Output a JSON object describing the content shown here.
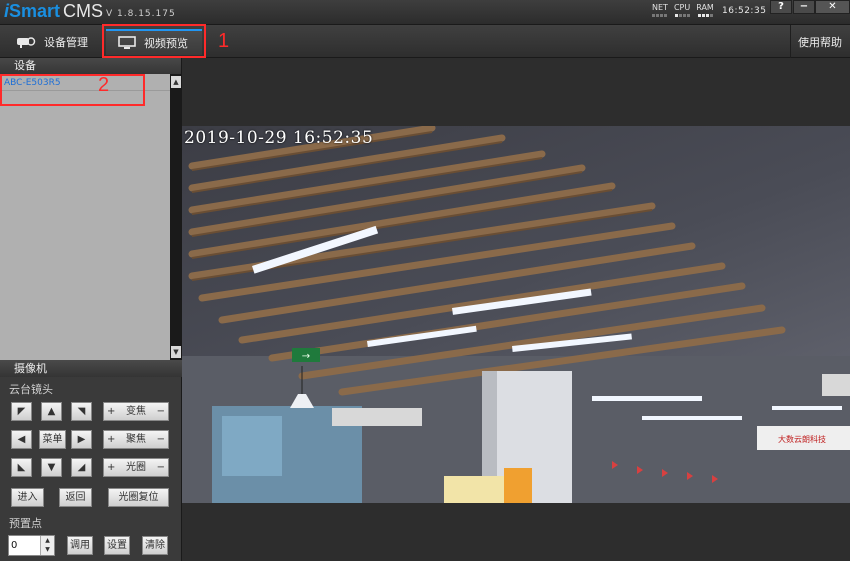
{
  "app": {
    "logo_i": "i",
    "logo_smart": "Smart",
    "logo_cms": "CMS",
    "version": "V 1.8.15.175"
  },
  "status": {
    "meters": [
      {
        "label": "NET",
        "dots_on": 0
      },
      {
        "label": "CPU",
        "dots_on": 1
      },
      {
        "label": "RAM",
        "dots_on": 3
      }
    ],
    "clock": "16:52:35"
  },
  "window_controls": {
    "help": "?",
    "minimize": "−",
    "close": "✕"
  },
  "toolbar": {
    "device_mgmt": "设备管理",
    "video_preview": "视频预览",
    "help": "使用帮助"
  },
  "annotations": {
    "one": "1",
    "two": "2"
  },
  "device_panel": {
    "title": "设备",
    "items": [
      {
        "label": "ABC-E503R5"
      }
    ]
  },
  "camera_panel": {
    "title": "摄像机",
    "ptz_label": "云台镜头",
    "arrows": {
      "up_left": "◤",
      "up": "▲",
      "up_right": "◥",
      "left": "◀",
      "menu": "菜单",
      "right": "▶",
      "down_left": "◣",
      "down": "▼",
      "down_right": "◢"
    },
    "zoom": {
      "plus": "+",
      "label": "变焦",
      "minus": "−"
    },
    "focus": {
      "plus": "+",
      "label": "聚焦",
      "minus": "−"
    },
    "iris": {
      "plus": "+",
      "label": "光圈",
      "minus": "−"
    },
    "enter": "进入",
    "back": "返回",
    "iris_reset": "光圈复位",
    "preset_label": "预置点",
    "preset_value": "0",
    "call": "调用",
    "set": "设置",
    "clear": "清除"
  },
  "video": {
    "osd_timestamp": "2019-10-29 16:52:35",
    "exit_sign": "→",
    "wall_sign": "大数云朗科技"
  },
  "colors": {
    "accent": "#2196f3",
    "annotation": "#ff2a2a",
    "device_text": "#1e6fd6"
  }
}
